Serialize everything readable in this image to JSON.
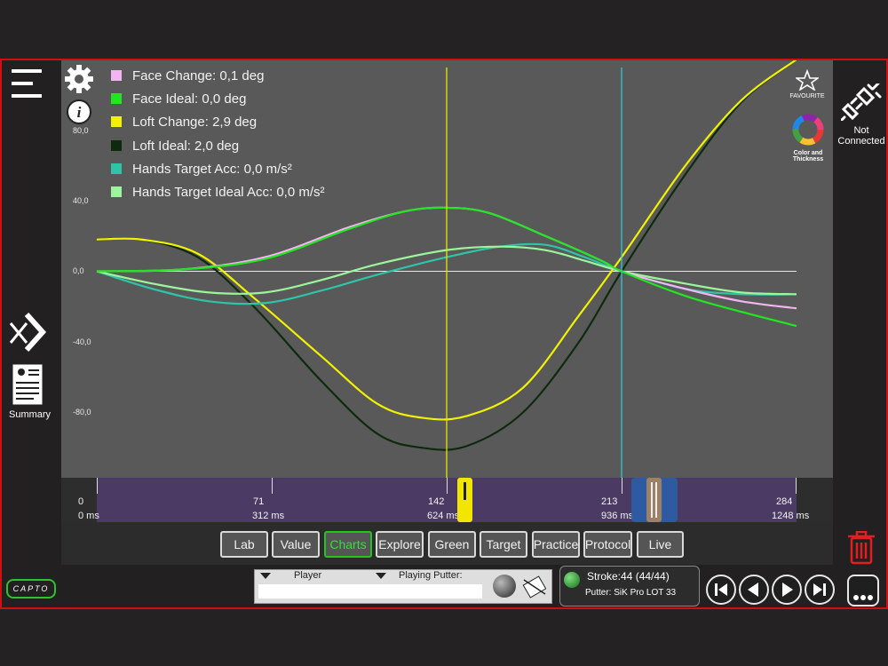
{
  "legend": [
    {
      "label": "Face Change: 0,1 deg",
      "color": "#f3b5f0"
    },
    {
      "label": "Face Ideal: 0,0 deg",
      "color": "#22e622"
    },
    {
      "label": "Loft Change: 2,9 deg",
      "color": "#f2f200"
    },
    {
      "label": "Loft Ideal: 2,0 deg",
      "color": "#0e2a0e"
    },
    {
      "label": "Hands Target Acc: 0,0 m/s²",
      "color": "#2ec4a8"
    },
    {
      "label": "Hands Target Ideal Acc: 0,0 m/s²",
      "color": "#9cf59a"
    }
  ],
  "yticks": [
    "80,0",
    "40,0",
    "0,0",
    "-40,0",
    "-80,0"
  ],
  "toolbar": {
    "favourite": "FAVOURITE",
    "color_thickness_1": "Color and",
    "color_thickness_2": "Thickness",
    "not_connected_1": "Not",
    "not_connected_2": "Connected",
    "summary": "Summary",
    "logo": "CAPTO"
  },
  "timeline": {
    "frames": [
      "0",
      "71",
      "142",
      "213",
      "284"
    ],
    "times": [
      "0 ms",
      "312 ms",
      "624 ms",
      "936 ms",
      "1248 ms"
    ]
  },
  "tabs": [
    "Lab",
    "Value",
    "Charts",
    "Explore",
    "Green",
    "Target",
    "Practice",
    "Protocol",
    "Live"
  ],
  "active_tab": "Charts",
  "player": {
    "player_label": "Player",
    "putter_label": "Playing Putter:"
  },
  "stroke": {
    "count": "Stroke:44 (44/44)",
    "putter": "Putter: SiK Pro LOT 33"
  },
  "chart_data": {
    "type": "line",
    "ylim": [
      -100,
      100
    ],
    "x_range": [
      0,
      1248
    ],
    "cursors_ms": [
      624,
      936
    ],
    "series": [
      {
        "name": "Face Change: 0,1 deg",
        "color": "#f3b5f0",
        "points": [
          [
            0,
            0
          ],
          [
            150,
            1
          ],
          [
            300,
            8
          ],
          [
            450,
            25
          ],
          [
            550,
            34
          ],
          [
            624,
            36
          ],
          [
            700,
            33
          ],
          [
            800,
            20
          ],
          [
            900,
            6
          ],
          [
            936,
            0
          ],
          [
            1050,
            -10
          ],
          [
            1150,
            -17
          ],
          [
            1248,
            -21
          ]
        ]
      },
      {
        "name": "Face Ideal: 0,0 deg",
        "color": "#22e622",
        "points": [
          [
            0,
            0
          ],
          [
            150,
            1
          ],
          [
            300,
            7
          ],
          [
            450,
            24
          ],
          [
            550,
            34
          ],
          [
            624,
            36
          ],
          [
            700,
            33
          ],
          [
            800,
            20
          ],
          [
            900,
            6
          ],
          [
            936,
            0
          ],
          [
            1050,
            -14
          ],
          [
            1150,
            -23
          ],
          [
            1248,
            -31
          ]
        ]
      },
      {
        "name": "Loft Change: 2,9 deg",
        "color": "#f2f200",
        "points": [
          [
            0,
            18
          ],
          [
            80,
            18
          ],
          [
            180,
            10
          ],
          [
            280,
            -15
          ],
          [
            400,
            -48
          ],
          [
            500,
            -75
          ],
          [
            580,
            -83
          ],
          [
            660,
            -82
          ],
          [
            760,
            -66
          ],
          [
            860,
            -25
          ],
          [
            936,
            8
          ],
          [
            1050,
            60
          ],
          [
            1150,
            97
          ],
          [
            1248,
            120
          ]
        ]
      },
      {
        "name": "Loft Ideal: 2,0 deg",
        "color": "#0e2a0e",
        "points": [
          [
            0,
            18
          ],
          [
            80,
            18
          ],
          [
            180,
            8
          ],
          [
            280,
            -20
          ],
          [
            400,
            -62
          ],
          [
            500,
            -92
          ],
          [
            580,
            -100
          ],
          [
            660,
            -99
          ],
          [
            760,
            -80
          ],
          [
            860,
            -40
          ],
          [
            936,
            0
          ],
          [
            1050,
            55
          ],
          [
            1150,
            96
          ],
          [
            1248,
            120
          ]
        ]
      },
      {
        "name": "Hands Target Acc: 0,0 m/s²",
        "color": "#2ec4a8",
        "points": [
          [
            0,
            0
          ],
          [
            100,
            -10
          ],
          [
            200,
            -17
          ],
          [
            300,
            -18
          ],
          [
            400,
            -11
          ],
          [
            500,
            -2
          ],
          [
            624,
            8
          ],
          [
            720,
            14
          ],
          [
            800,
            15
          ],
          [
            870,
            8
          ],
          [
            936,
            0
          ],
          [
            1050,
            -10
          ],
          [
            1150,
            -13
          ],
          [
            1248,
            -13
          ]
        ]
      },
      {
        "name": "Hands Target Ideal Acc: 0,0 m/s²",
        "color": "#9cf59a",
        "points": [
          [
            0,
            0
          ],
          [
            100,
            -7
          ],
          [
            200,
            -12
          ],
          [
            300,
            -12
          ],
          [
            400,
            -5
          ],
          [
            500,
            4
          ],
          [
            624,
            12
          ],
          [
            720,
            14
          ],
          [
            800,
            12
          ],
          [
            870,
            6
          ],
          [
            936,
            0
          ],
          [
            1050,
            -7
          ],
          [
            1150,
            -12
          ],
          [
            1248,
            -13
          ]
        ]
      }
    ]
  }
}
